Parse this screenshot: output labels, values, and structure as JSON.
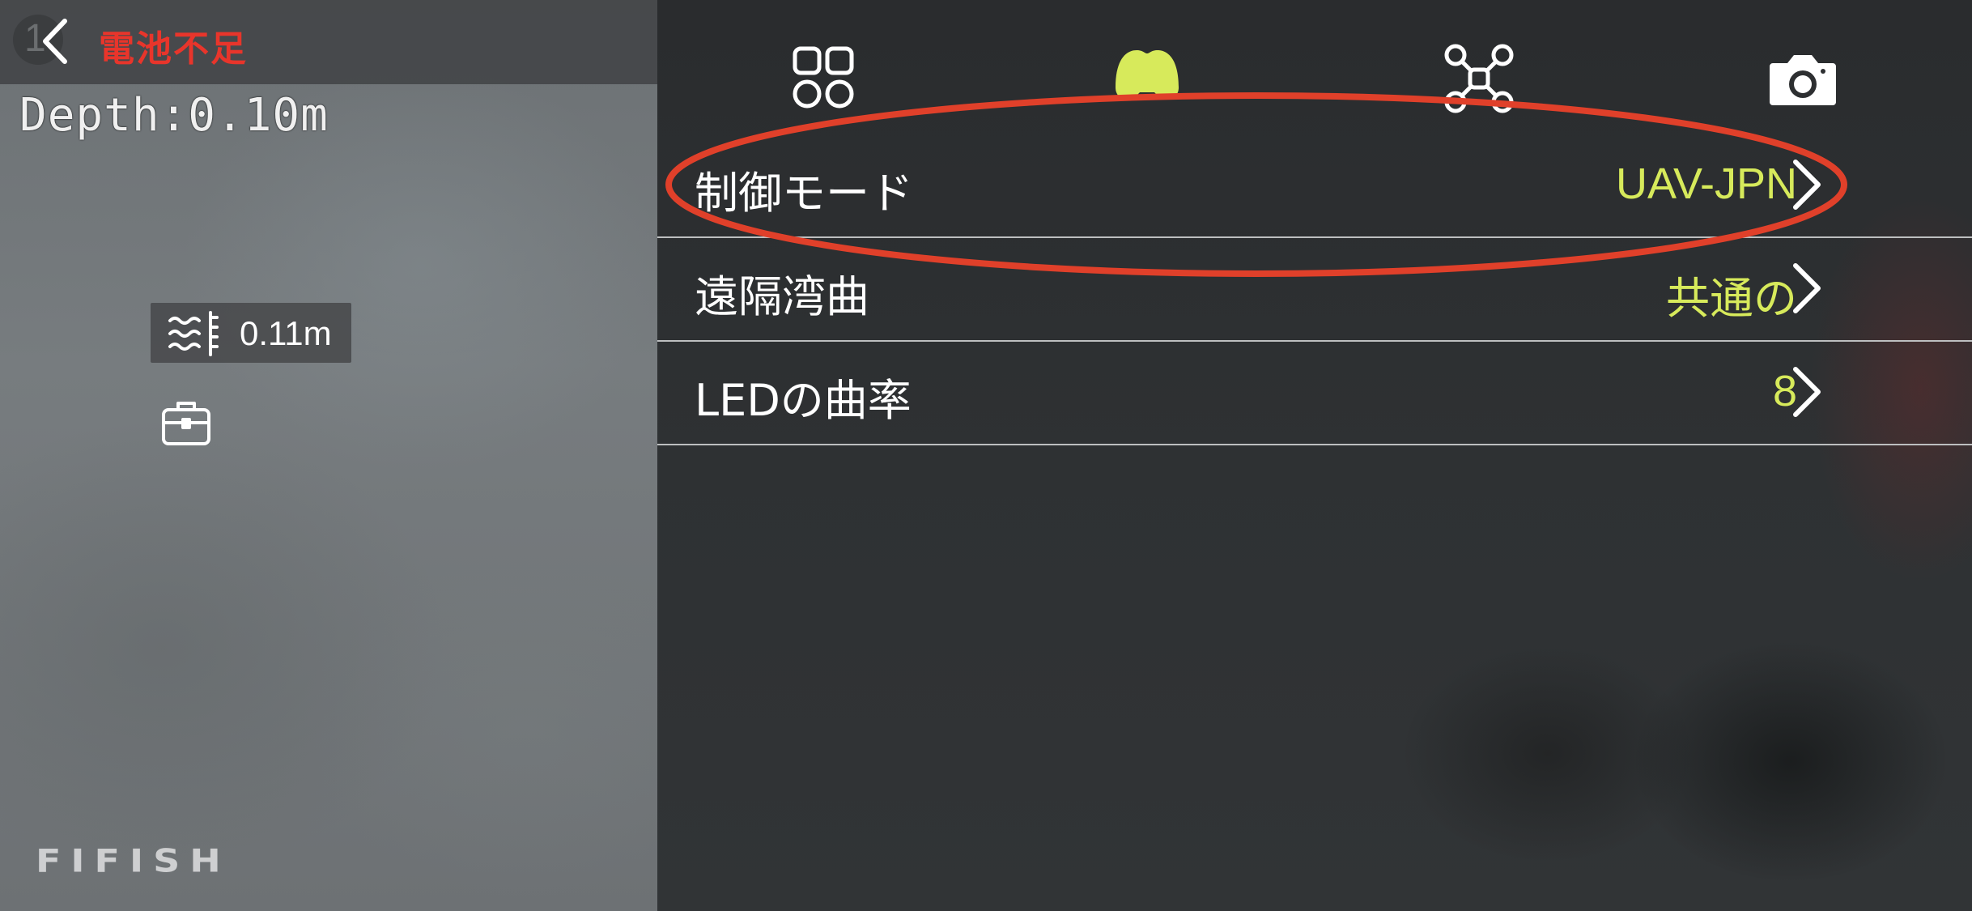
{
  "status": {
    "back_counter": "1",
    "battery_warning": "電池不足",
    "battery_warning_color": "#e8352b"
  },
  "camera_view": {
    "depth_text": "Depth:0.10m",
    "depth_chip_value": "0.11m",
    "brand": "FIFISH"
  },
  "tabs": [
    {
      "icon": "grid-icon",
      "active": false
    },
    {
      "icon": "controller-icon",
      "active": true
    },
    {
      "icon": "drone-icon",
      "active": false
    },
    {
      "icon": "camera-icon",
      "active": false
    }
  ],
  "settings": {
    "rows": [
      {
        "label": "制御モード",
        "value": "UAV-JPN"
      },
      {
        "label": "遠隔湾曲",
        "value": "共通の"
      },
      {
        "label": "LEDの曲率",
        "value": "8"
      }
    ]
  },
  "colors": {
    "accent": "#d7ea5b",
    "warning": "#e8352b",
    "annotation": "#e0402a"
  }
}
